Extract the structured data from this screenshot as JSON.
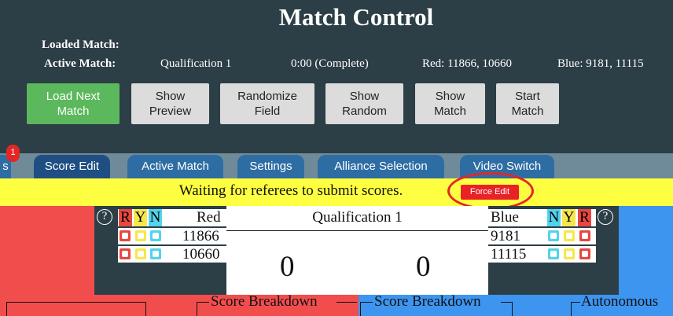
{
  "header": {
    "title": "Match Control",
    "loaded_match_label": "Loaded Match:",
    "active_match_label": "Active Match:",
    "active_match_name": "Qualification 1",
    "active_match_time": "0:00 (Complete)",
    "red_teams": "Red: 11866, 10660",
    "blue_teams": "Blue: 9181, 11115"
  },
  "buttons": [
    {
      "line1": "Load Next",
      "line2": "Match"
    },
    {
      "line1": "Show",
      "line2": "Preview"
    },
    {
      "line1": "Randomize",
      "line2": "Field"
    },
    {
      "line1": "Show",
      "line2": "Random"
    },
    {
      "line1": "Show",
      "line2": "Match"
    },
    {
      "line1": "Start",
      "line2": "Match"
    }
  ],
  "tabs": {
    "partial": "s",
    "badge": "1",
    "items": [
      "Score Edit",
      "Active Match",
      "Settings",
      "Alliance Selection",
      "Video Switch"
    ]
  },
  "status": {
    "waiting_text": "Waiting for referees to submit scores.",
    "force_edit_label": "Force Edit"
  },
  "score_table": {
    "help": "?",
    "red_header": {
      "r": "R",
      "y": "Y",
      "n": "N",
      "label": "Red"
    },
    "blue_header": {
      "n": "N",
      "y": "Y",
      "r": "R",
      "label": "Blue"
    },
    "red_teams": [
      "11866",
      "10660"
    ],
    "blue_teams": [
      "9181",
      "11115"
    ],
    "match_name": "Qualification 1",
    "red_score": "0",
    "blue_score": "0"
  },
  "breakdown": {
    "red_label": "Score Breakdown",
    "blue_label": "Score Breakdown",
    "autonomous_label": "Autonomous"
  },
  "colors": {
    "header_bg": "#2c3e46",
    "green": "#5cb85c",
    "tab_blue": "#2e6da4",
    "yellow_bar": "#ffff41",
    "red_field": "#f24d4d",
    "blue_field": "#3d95f0",
    "force_red": "#e82227",
    "card_red": "#e8473f",
    "card_yellow": "#f6e84c",
    "card_cyan": "#53d3ec"
  }
}
